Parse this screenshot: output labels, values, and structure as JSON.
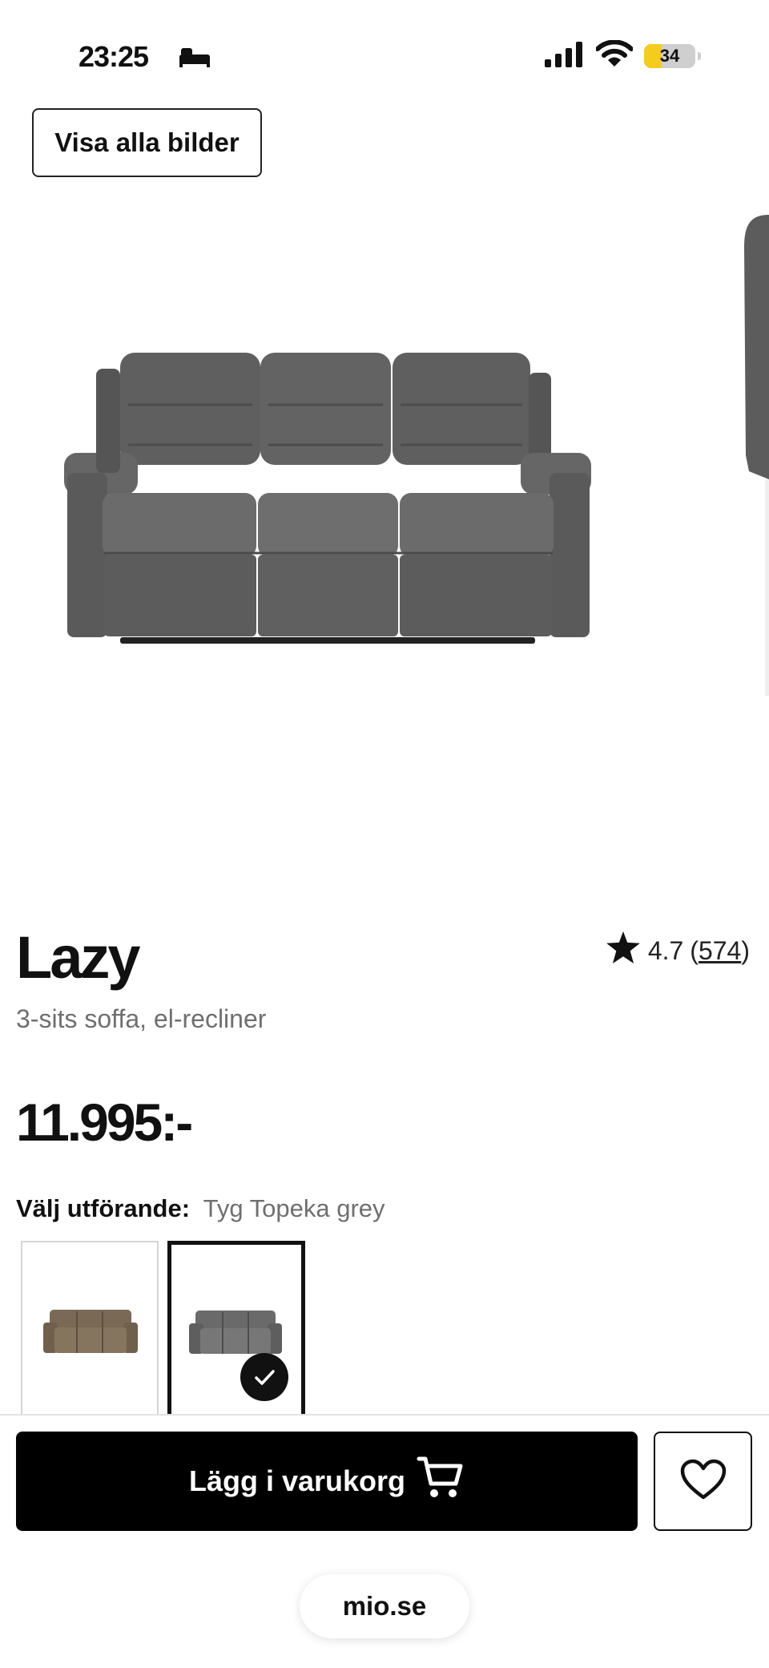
{
  "status_bar": {
    "time": "23:25",
    "battery": "34",
    "battery_level": 0.34,
    "icons": [
      "sleep-icon",
      "signal-icon",
      "wifi-icon",
      "battery-icon"
    ]
  },
  "gallery": {
    "show_all_label": "Visa alla bilder"
  },
  "product": {
    "title": "Lazy",
    "subtitle": "3-sits soffa, el-recliner",
    "rating": "4.7",
    "review_count": "574",
    "price": "11.995:-"
  },
  "variants": {
    "label": "Välj utförande:",
    "selected": "Tyg Topeka grey",
    "options": [
      {
        "color": "#7a6a55",
        "selected": false
      },
      {
        "color": "#6a6a6a",
        "selected": true
      }
    ]
  },
  "actions": {
    "add_to_cart_label": "Lägg i varukorg",
    "url": "mio.se"
  },
  "colors": {
    "primary_button": "#000000",
    "star": "#111111",
    "sofa_grey": "#5f5f5f",
    "battery_accent": "#f5cc1b"
  }
}
